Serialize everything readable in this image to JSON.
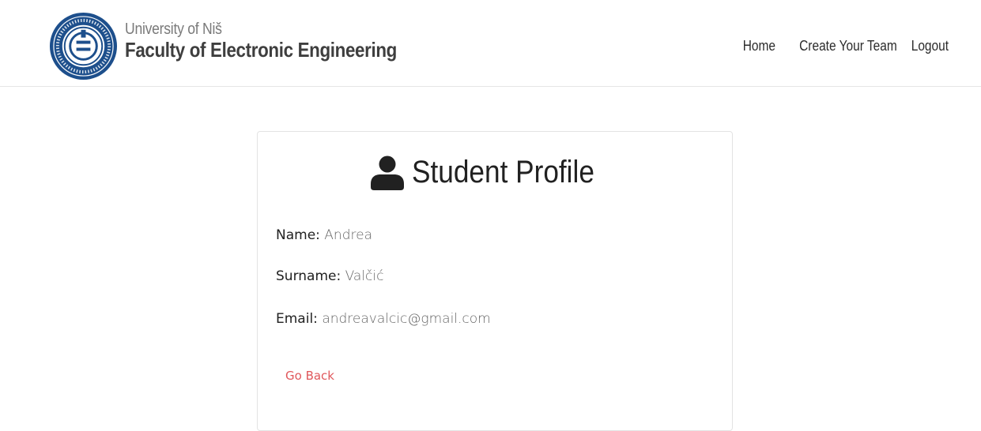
{
  "header": {
    "university": "University of Niš",
    "faculty": "Faculty of Electronic Engineering",
    "logo_icon": "faculty-seal-logo",
    "nav": [
      {
        "label": "Home"
      },
      {
        "label": "Create Your Team"
      },
      {
        "label": "Logout"
      }
    ]
  },
  "profile": {
    "title": "Student Profile",
    "title_icon": "user-icon",
    "fields": [
      {
        "label": "Name:",
        "value": "Andrea"
      },
      {
        "label": "Surname:",
        "value": "Valčić"
      },
      {
        "label": "Email:",
        "value": "andreavalcic@gmail.com"
      }
    ],
    "back_label": "Go Back"
  },
  "colors": {
    "accent_link": "#e0575b",
    "logo_blue": "#1d4f8c"
  }
}
